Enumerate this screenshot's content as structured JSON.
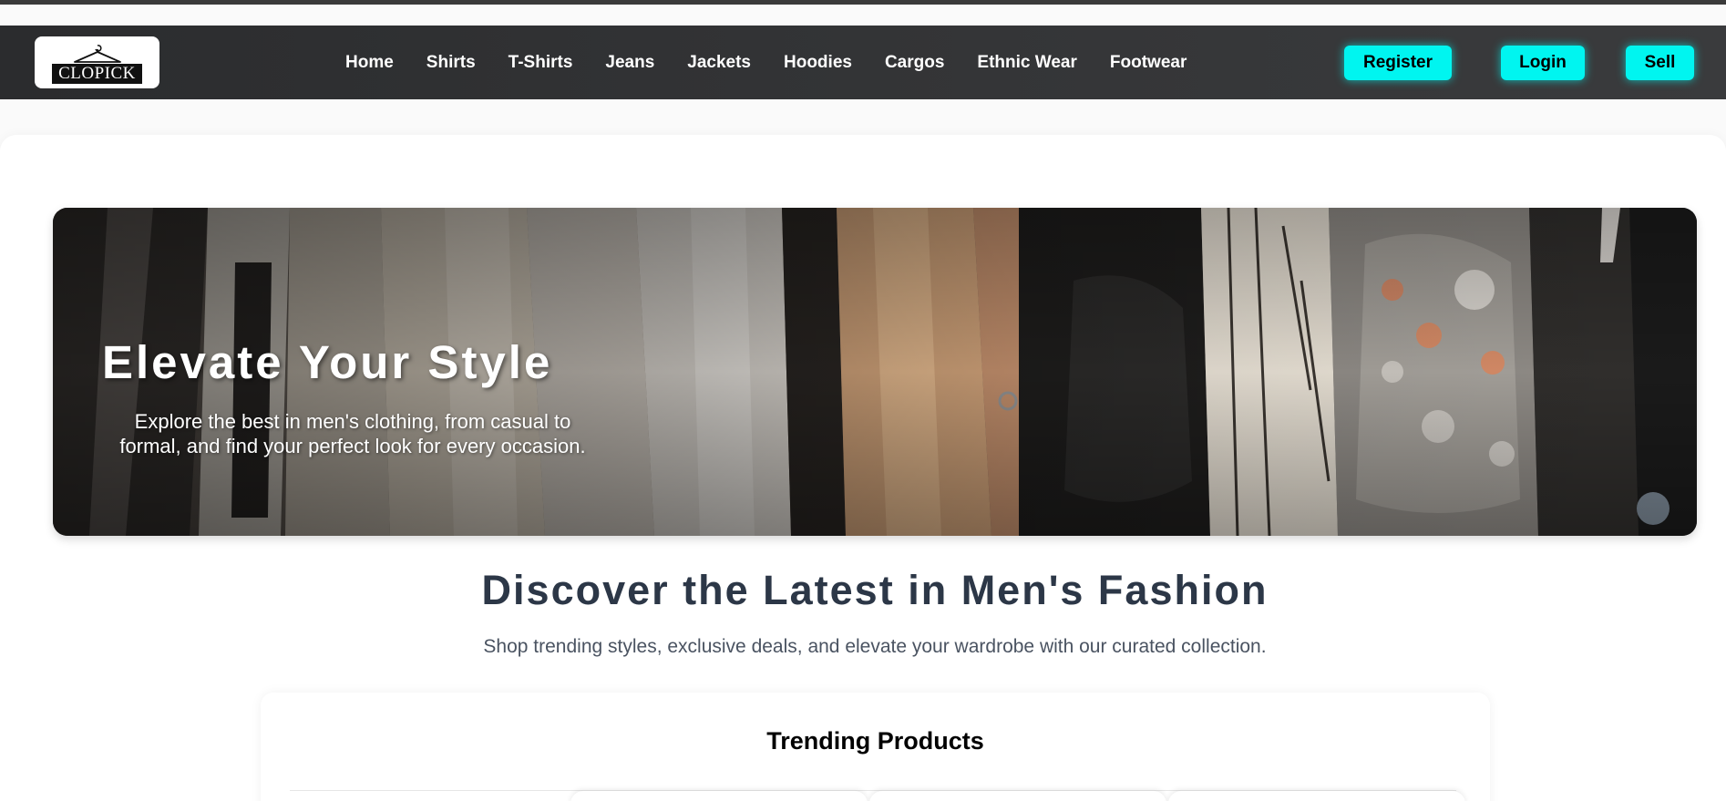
{
  "brand": {
    "logo_text": "CLOPICK"
  },
  "nav": {
    "links": [
      "Home",
      "Shirts",
      "T-Shirts",
      "Jeans",
      "Jackets",
      "Hoodies",
      "Cargos",
      "Ethnic Wear",
      "Footwear"
    ],
    "register_label": "Register",
    "login_label": "Login",
    "sell_label": "Sell"
  },
  "hero": {
    "title": "Elevate Your Style",
    "subtitle": "Explore the best in men's clothing, from casual to formal, and find your perfect look for every occasion."
  },
  "discover": {
    "title": "Discover the Latest in Men's Fashion",
    "subtitle": "Shop trending styles, exclusive deals, and elevate your wardrobe with our curated collection."
  },
  "trending": {
    "title": "Trending Products"
  },
  "colors": {
    "accent": "#00f5f0",
    "navbar": "#2b2c2e",
    "heading": "#2c3747"
  }
}
